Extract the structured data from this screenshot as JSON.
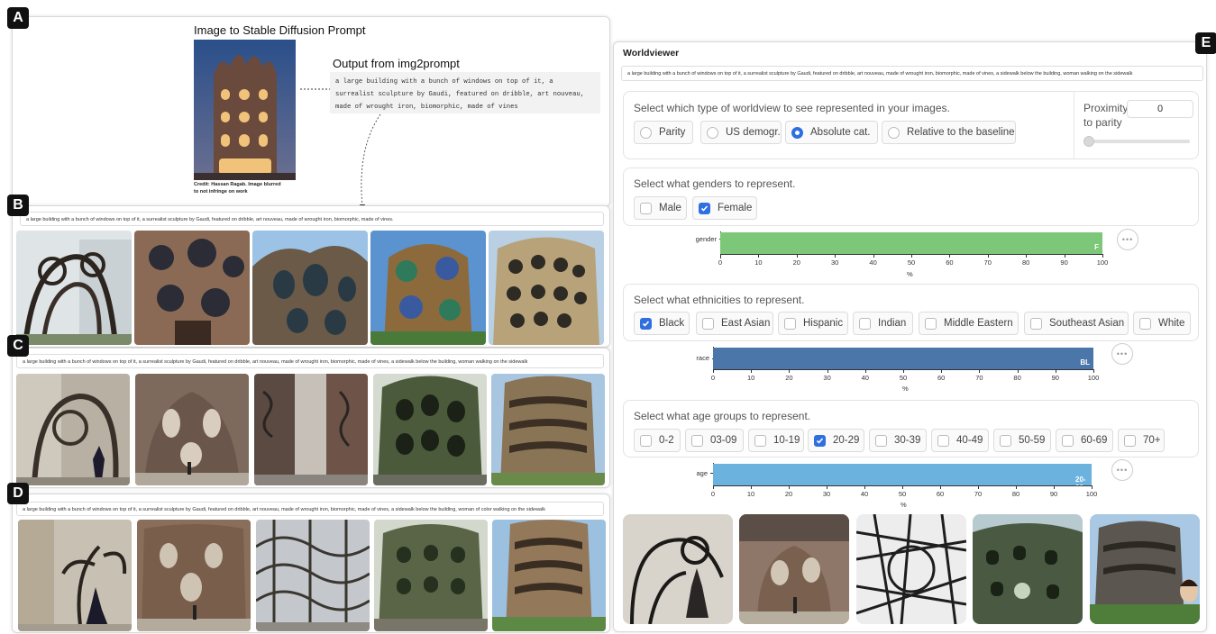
{
  "badges": {
    "a": "A",
    "b": "B",
    "c": "C",
    "d": "D",
    "e": "E"
  },
  "panel_a": {
    "title": "Image to Stable Diffusion Prompt",
    "credit_line1": "Credit: Hassan Ragab. Image blurred",
    "credit_line2": "to not infringe on work",
    "output_title": "Output from img2prompt",
    "output_text": "a large building with a bunch of windows on top of it, a surrealist sculpture by Gaudi, featured on dribble, art nouveau, made of wrought iron, biomorphic, made of vines"
  },
  "panel_b": {
    "prompt": "a large building with a bunch of windows on top of it, a surrealist sculpture by Gaudi, featured on dribble, art nouveau, made of wrought iron, biomorphic, made of vines."
  },
  "panel_c": {
    "prompt": "a large building with a bunch of windows on top of it, a surrealist sculpture by Gaudi, featured on dribble, art nouveau, made of wrought iron, biomorphic, made of vines, a sidewalk below the building, woman walking on the sidewalk"
  },
  "panel_d": {
    "prompt": "a large building with a bunch of windows on top of it, a surrealist sculpture by Gaudi, featured on dribble, art nouveau, made of wrought iron, biomorphic, made of vines, a sidewalk below the building,  woman of color walking on the sidewalk"
  },
  "worldviewer": {
    "title": "Worldviewer",
    "prompt": "a large building with a bunch of windows on top of it, a surrealist sculpture by Gaudi, featured on dribble, art nouveau, made of wrought iron, biomorphic, made of vines, a sidewalk below the building, woman walking on the sidewalk",
    "worldview_label": "Select which type of worldview to see represented in your images.",
    "worldview_options": [
      "Parity",
      "US demogr.",
      "Absolute cat.",
      "Relative to the baseline"
    ],
    "proximity_label_1": "Proximity",
    "proximity_label_2": "to parity",
    "proximity_value": "0",
    "gender_label": "Select what genders to represent.",
    "gender_options": [
      "Male",
      "Female"
    ],
    "ethnicity_label": "Select what ethnicities to represent.",
    "ethnicity_options": [
      "Black",
      "East Asian",
      "Hispanic",
      "Indian",
      "Middle Eastern",
      "Southeast Asian",
      "White"
    ],
    "age_label": "Select what age groups to represent.",
    "age_options": [
      "0-2",
      "03-09",
      "10-19",
      "20-29",
      "30-39",
      "40-49",
      "50-59",
      "60-69",
      "70+"
    ],
    "more_icon": "•••"
  },
  "chart_data": [
    {
      "type": "bar",
      "categories": [
        "gender"
      ],
      "values": [
        100
      ],
      "bar_label": "F",
      "xlabel": "%",
      "xlim": [
        0,
        100
      ],
      "ticks": [
        0,
        10,
        20,
        30,
        40,
        50,
        60,
        70,
        80,
        90,
        100
      ],
      "color": "#7dc878"
    },
    {
      "type": "bar",
      "categories": [
        "race"
      ],
      "values": [
        100
      ],
      "bar_label": "BL",
      "xlabel": "%",
      "xlim": [
        0,
        100
      ],
      "ticks": [
        0,
        10,
        20,
        30,
        40,
        50,
        60,
        70,
        80,
        90,
        100
      ],
      "color": "#4a76aa"
    },
    {
      "type": "bar",
      "categories": [
        "age"
      ],
      "values": [
        100
      ],
      "bar_label": "20-29",
      "xlabel": "%",
      "xlim": [
        0,
        100
      ],
      "ticks": [
        0,
        10,
        20,
        30,
        40,
        50,
        60,
        70,
        80,
        90,
        100
      ],
      "color": "#6cb2de"
    }
  ]
}
